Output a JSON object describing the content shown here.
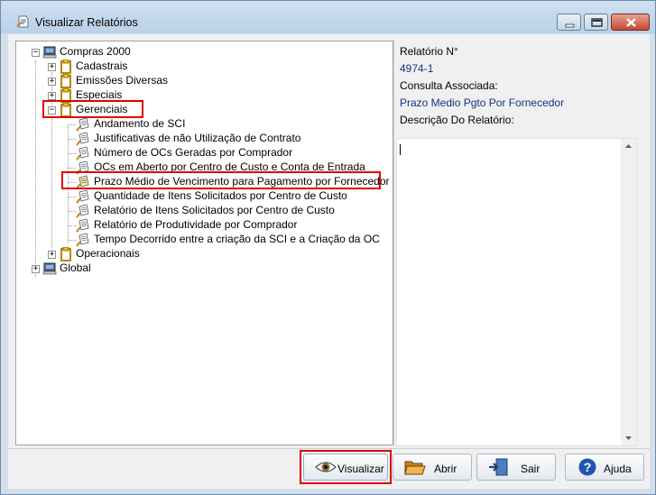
{
  "window": {
    "title": "Visualizar Relatórios"
  },
  "tree": {
    "root": "Compras 2000",
    "categories": [
      "Cadastrais",
      "Emissões Diversas",
      "Especiais",
      "Gerenciais"
    ],
    "reports": [
      "Andamento de SCI",
      "Justificativas de não Utilização de Contrato",
      "Número de OCs Geradas por Comprador",
      "OCs em Aberto por Centro de Custo e Conta de Entrada",
      "Prazo Médio de Vencimento para Pagamento por Fornecedor",
      "Quantidade de Itens Solicitados por Centro de Custo",
      "Relatório de Itens Solicitados por Centro de Custo",
      "Relatório de Produtividade por Comprador",
      "Tempo Decorrido entre a criação da SCI e a Criação da OC"
    ],
    "after_category": "Operacionais",
    "global": "Global"
  },
  "info": {
    "report_number_label": "Relatório N°",
    "report_number": "4974-1",
    "query_label": "Consulta Associada:",
    "query_value": "Prazo Medio Pgto Por Fornecedor",
    "description_label": "Descrição Do Relatório:"
  },
  "buttons": {
    "view": "Visualizar",
    "open": "Abrir",
    "exit": "Sair",
    "help": "Ajuda"
  },
  "colors": {
    "highlight": "#e00000",
    "link_value": "#1a2e8a"
  }
}
